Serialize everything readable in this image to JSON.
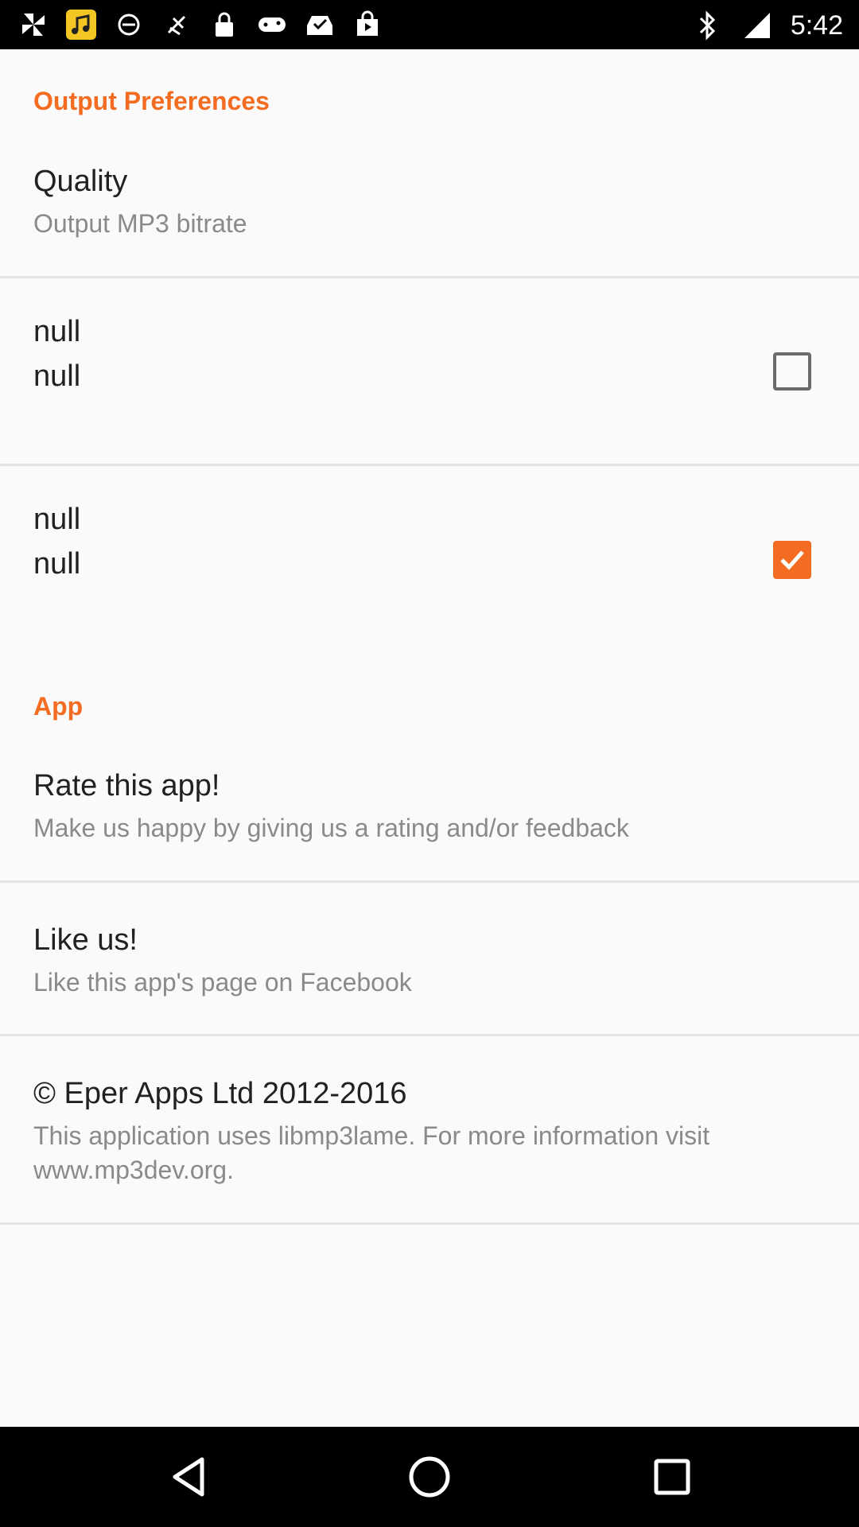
{
  "status_bar": {
    "time": "5:42",
    "left_icons": [
      "pinwheel-icon",
      "music-app-icon",
      "sync-icon",
      "no-gps-icon",
      "lock-icon",
      "gamepad-icon",
      "inbox-check-icon",
      "store-bag-icon"
    ],
    "right_icons": [
      "bluetooth-icon",
      "signal-icon"
    ]
  },
  "sections": {
    "output": {
      "header": "Output Preferences",
      "quality": {
        "title": "Quality",
        "summary": "Output MP3 bitrate"
      },
      "pref1": {
        "title": "null",
        "summary": "null",
        "checked": false
      },
      "pref2": {
        "title": "null",
        "summary": "null",
        "checked": true
      }
    },
    "app": {
      "header": "App",
      "rate": {
        "title": "Rate this app!",
        "summary": "Make us happy by giving us a rating and/or feedback"
      },
      "like": {
        "title": "Like us!",
        "summary": "Like this app's page on Facebook"
      },
      "about": {
        "title": "© Eper Apps Ltd 2012-2016",
        "summary": "This application uses libmp3lame. For more information visit www.mp3dev.org."
      }
    }
  },
  "colors": {
    "accent": "#f36c21",
    "title": "#212121",
    "summary": "#8a8a8a",
    "background": "#fafafa"
  },
  "nav_bar": {
    "buttons": [
      "back-icon",
      "home-icon",
      "recents-icon"
    ]
  }
}
